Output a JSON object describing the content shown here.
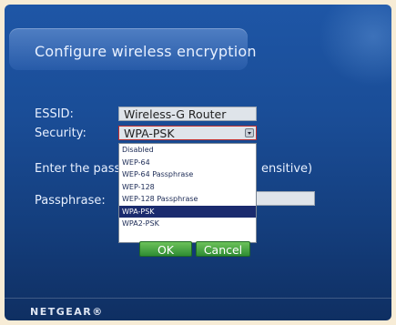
{
  "page": {
    "title": "Configure wireless encryption"
  },
  "form": {
    "essid_label": "ESSID:",
    "essid_value": "Wireless-G Router",
    "security_label": "Security:",
    "security_value": "WPA-PSK",
    "passphrase_hint_left": "Enter the passph",
    "passphrase_hint_right": "ensitive)",
    "passphrase_label": "Passphrase:",
    "passphrase_value": ""
  },
  "dropdown": {
    "options": [
      "Disabled",
      "WEP-64",
      "WEP-64 Passphrase",
      "WEP-128",
      "WEP-128 Passphrase",
      "WPA-PSK",
      "WPA2-PSK"
    ],
    "selected": "WPA-PSK"
  },
  "buttons": {
    "ok": "OK",
    "cancel": "Cancel"
  },
  "footer": {
    "brand": "NETGEAR®"
  },
  "colors": {
    "background_top": "#1e56a6",
    "background_bottom": "#0f2f62",
    "selection": "#1a2b6e",
    "button_green": "#2f8d33",
    "focus_border": "#c03030"
  },
  "icons": {
    "dropdown": "chevron-down-icon"
  }
}
